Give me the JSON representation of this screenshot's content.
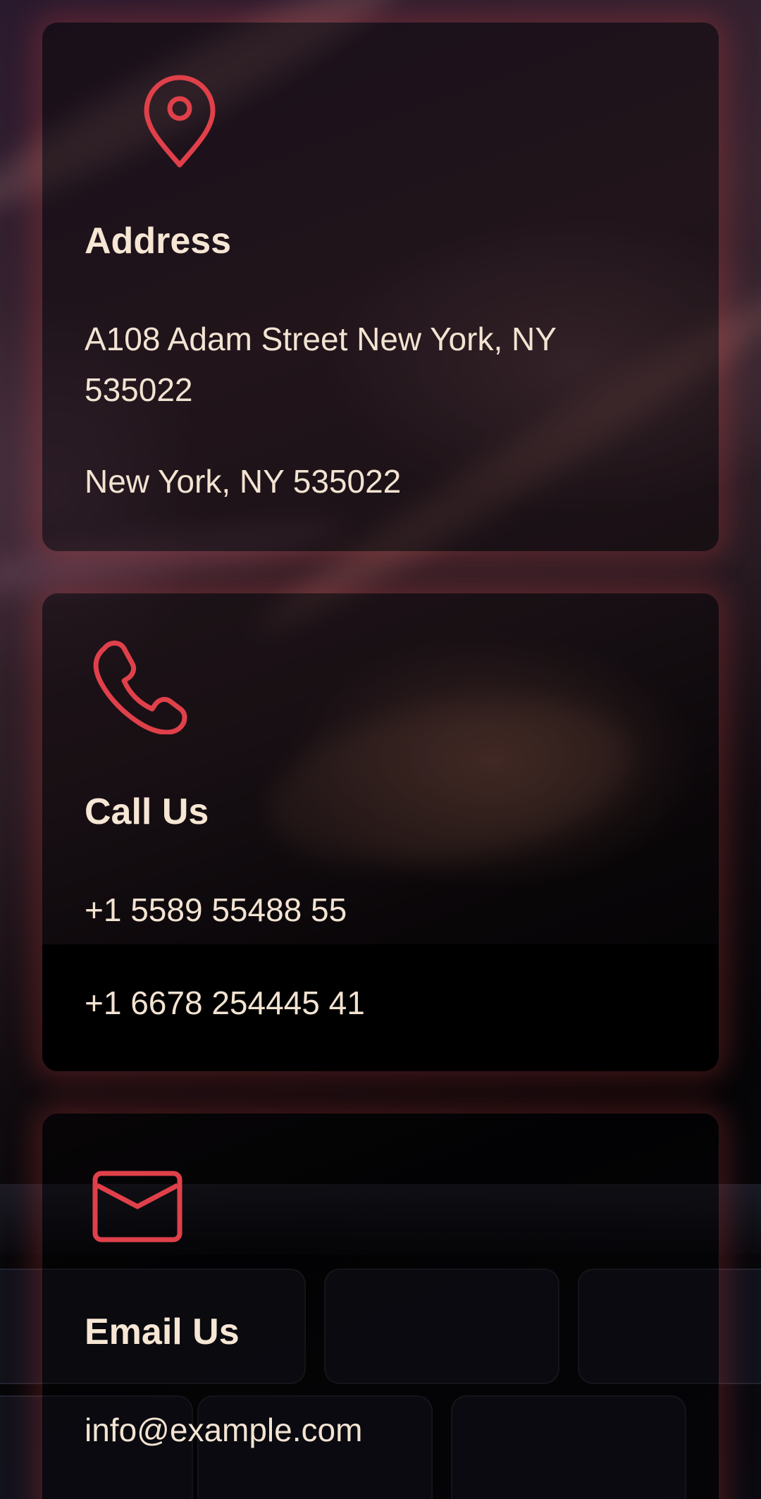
{
  "colors": {
    "accent": "#e0404a",
    "text": "#f3e3d2",
    "card_bg": "rgba(0,0,0,0.42)"
  },
  "cards": [
    {
      "icon": "map-pin-icon",
      "title": "Address",
      "lines": [
        "A108 Adam Street New York, NY 535022",
        "New York, NY 535022"
      ]
    },
    {
      "icon": "phone-icon",
      "title": "Call Us",
      "lines": [
        "+1 5589 55488 55",
        "+1 6678 254445 41"
      ]
    },
    {
      "icon": "envelope-icon",
      "title": "Email Us",
      "lines": [
        "info@example.com"
      ]
    }
  ]
}
